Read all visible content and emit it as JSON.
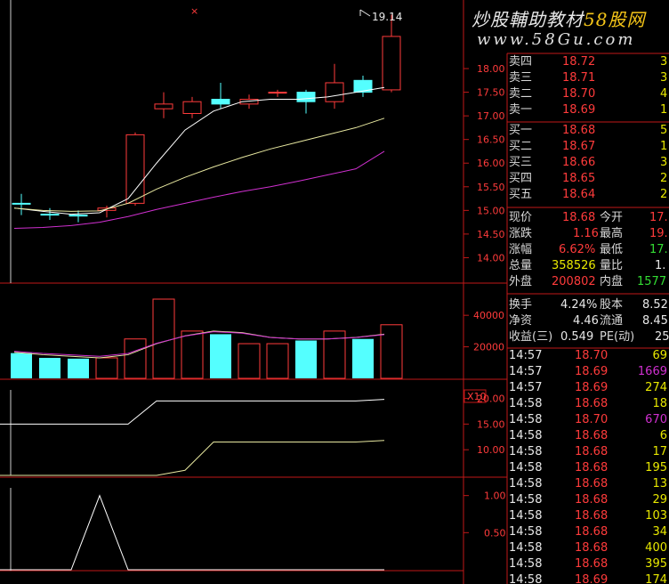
{
  "watermark": {
    "line1": "炒股輔助教材",
    "brand": "58股网",
    "url": "www.58Gu.com"
  },
  "chart": {
    "high_marker": "19.14",
    "price_axis": [
      "18.00",
      "17.50",
      "17.00",
      "16.50",
      "16.00",
      "15.50",
      "15.00",
      "14.50",
      "14.00"
    ],
    "volume_axis": [
      "40000",
      "20000"
    ],
    "volume_unit": "X10",
    "ind1_axis": [
      "20.00",
      "15.00",
      "10.00"
    ],
    "ind2_axis": [
      "1.00",
      "0.50"
    ],
    "price_range": [
      13.5,
      19.3
    ],
    "candles": [
      {
        "o": 15.15,
        "h": 15.35,
        "l": 14.9,
        "c": 15.15,
        "up": false
      },
      {
        "o": 14.92,
        "h": 15.05,
        "l": 14.8,
        "c": 14.92,
        "up": false
      },
      {
        "o": 14.9,
        "h": 15.0,
        "l": 14.75,
        "c": 14.9,
        "up": false
      },
      {
        "o": 15.0,
        "h": 15.1,
        "l": 14.85,
        "c": 15.05,
        "up": true
      },
      {
        "o": 15.15,
        "h": 16.65,
        "l": 15.1,
        "c": 16.6,
        "up": true
      },
      {
        "o": 17.15,
        "h": 17.5,
        "l": 16.95,
        "c": 17.25,
        "up": true
      },
      {
        "o": 17.05,
        "h": 17.4,
        "l": 16.95,
        "c": 17.3,
        "up": true
      },
      {
        "o": 17.35,
        "h": 17.7,
        "l": 17.15,
        "c": 17.25,
        "up": false
      },
      {
        "o": 17.25,
        "h": 17.45,
        "l": 17.15,
        "c": 17.35,
        "up": true
      },
      {
        "o": 17.5,
        "h": 17.55,
        "l": 17.4,
        "c": 17.5,
        "up": true
      },
      {
        "o": 17.5,
        "h": 17.55,
        "l": 17.05,
        "c": 17.3,
        "up": false
      },
      {
        "o": 17.3,
        "h": 18.1,
        "l": 17.15,
        "c": 17.7,
        "up": true
      },
      {
        "o": 17.75,
        "h": 17.85,
        "l": 17.4,
        "c": 17.5,
        "up": false
      },
      {
        "o": 17.55,
        "h": 19.14,
        "l": 17.5,
        "c": 18.68,
        "up": true
      }
    ],
    "ma_short": [
      15.05,
      14.98,
      14.92,
      14.95,
      15.25,
      16.0,
      16.7,
      17.1,
      17.3,
      17.35,
      17.35,
      17.4,
      17.5,
      17.6
    ],
    "ma_mid": [
      15.05,
      15.0,
      14.98,
      14.99,
      15.15,
      15.45,
      15.7,
      15.92,
      16.12,
      16.3,
      16.45,
      16.6,
      16.75,
      16.95
    ],
    "ma_long": [
      14.62,
      14.64,
      14.68,
      14.75,
      14.87,
      15.02,
      15.15,
      15.28,
      15.4,
      15.5,
      15.62,
      15.75,
      15.88,
      16.25
    ],
    "volume_range": [
      0,
      48000
    ],
    "volume": [
      16000,
      13000,
      12500,
      13000,
      25000,
      52000,
      30000,
      28000,
      22000,
      22000,
      24000,
      30000,
      25000,
      34000
    ],
    "volume_ma": [
      16500,
      15000,
      14000,
      13000,
      15000,
      22000,
      27000,
      30000,
      29000,
      26000,
      25000,
      25000,
      26000,
      28000
    ],
    "ind1_range": [
      5,
      22
    ],
    "ind1_a": [
      15,
      15,
      15,
      15,
      15,
      19.5,
      19.5,
      19.5,
      19.5,
      19.5,
      19.5,
      19.5,
      19.5,
      19.8
    ],
    "ind1_b": [
      5,
      5,
      5,
      5,
      5,
      5,
      6,
      11.5,
      11.5,
      11.5,
      11.5,
      11.5,
      11.5,
      11.8
    ],
    "ind2_range": [
      0,
      1.2
    ],
    "ind2": [
      0,
      0,
      0,
      1,
      0,
      0,
      0,
      0,
      0,
      0,
      0,
      0,
      0,
      0
    ]
  },
  "orderbook": {
    "asks": [
      {
        "label": "卖四",
        "price": "18.72",
        "vol": "3"
      },
      {
        "label": "卖三",
        "price": "18.71",
        "vol": "3"
      },
      {
        "label": "卖二",
        "price": "18.70",
        "vol": "4"
      },
      {
        "label": "卖一",
        "price": "18.69",
        "vol": "1"
      }
    ],
    "bids": [
      {
        "label": "买一",
        "price": "18.68",
        "vol": "5"
      },
      {
        "label": "买二",
        "price": "18.67",
        "vol": "1"
      },
      {
        "label": "买三",
        "price": "18.66",
        "vol": "3"
      },
      {
        "label": "买四",
        "price": "18.65",
        "vol": "2"
      },
      {
        "label": "买五",
        "price": "18.64",
        "vol": "2"
      }
    ]
  },
  "quote": {
    "xianjia_label": "现价",
    "xianjia": "18.68",
    "jinkai_label": "今开",
    "jinkai": "17.",
    "zhangdie_label": "涨跌",
    "zhangdie": "1.16",
    "zuigao_label": "最高",
    "zuigao": "19.",
    "zhangfu_label": "涨幅",
    "zhangfu": "6.62%",
    "zuidi_label": "最低",
    "zuidi": "17.",
    "zongliang_label": "总量",
    "zongliang": "358526",
    "liangbi_label": "量比",
    "liangbi": "1.",
    "waipan_label": "外盘",
    "waipan": "200802",
    "neipan_label": "内盘",
    "neipan": "1577"
  },
  "fundamentals": {
    "huanshou_label": "换手",
    "huanshou": "4.24%",
    "guben_label": "股本",
    "guben": "8.52",
    "jingzi_label": "净资",
    "jingzi": "4.46",
    "liutong_label": "流通",
    "liutong": "8.45",
    "shouyi_label": "收益(三)",
    "shouyi": "0.549",
    "pe_label": "PE(动)",
    "pe": "25"
  },
  "ticks": [
    {
      "time": "14:57",
      "price": "18.70",
      "vol": "69",
      "vc": "ylw"
    },
    {
      "time": "14:57",
      "price": "18.69",
      "vol": "1669",
      "vc": "prp"
    },
    {
      "time": "14:57",
      "price": "18.69",
      "vol": "274",
      "vc": "ylw"
    },
    {
      "time": "14:58",
      "price": "18.68",
      "vol": "18",
      "vc": "ylw"
    },
    {
      "time": "14:58",
      "price": "18.70",
      "vol": "670",
      "vc": "prp"
    },
    {
      "time": "14:58",
      "price": "18.68",
      "vol": "6",
      "vc": "ylw"
    },
    {
      "time": "14:58",
      "price": "18.68",
      "vol": "17",
      "vc": "ylw"
    },
    {
      "time": "14:58",
      "price": "18.68",
      "vol": "195",
      "vc": "ylw"
    },
    {
      "time": "14:58",
      "price": "18.68",
      "vol": "13",
      "vc": "ylw"
    },
    {
      "time": "14:58",
      "price": "18.68",
      "vol": "29",
      "vc": "ylw"
    },
    {
      "time": "14:58",
      "price": "18.68",
      "vol": "103",
      "vc": "ylw"
    },
    {
      "time": "14:58",
      "price": "18.68",
      "vol": "34",
      "vc": "ylw"
    },
    {
      "time": "14:58",
      "price": "18.68",
      "vol": "400",
      "vc": "ylw"
    },
    {
      "time": "14:58",
      "price": "18.68",
      "vol": "395",
      "vc": "ylw"
    },
    {
      "time": "14:58",
      "price": "18.69",
      "vol": "174",
      "vc": "ylw"
    }
  ],
  "colors": {
    "up": "#ff3b3b",
    "down": "#54ffff",
    "frame": "#c01818",
    "ma_short": "#ffffff",
    "ma_mid": "#e8e8a0",
    "ma_long": "#d030d0"
  }
}
